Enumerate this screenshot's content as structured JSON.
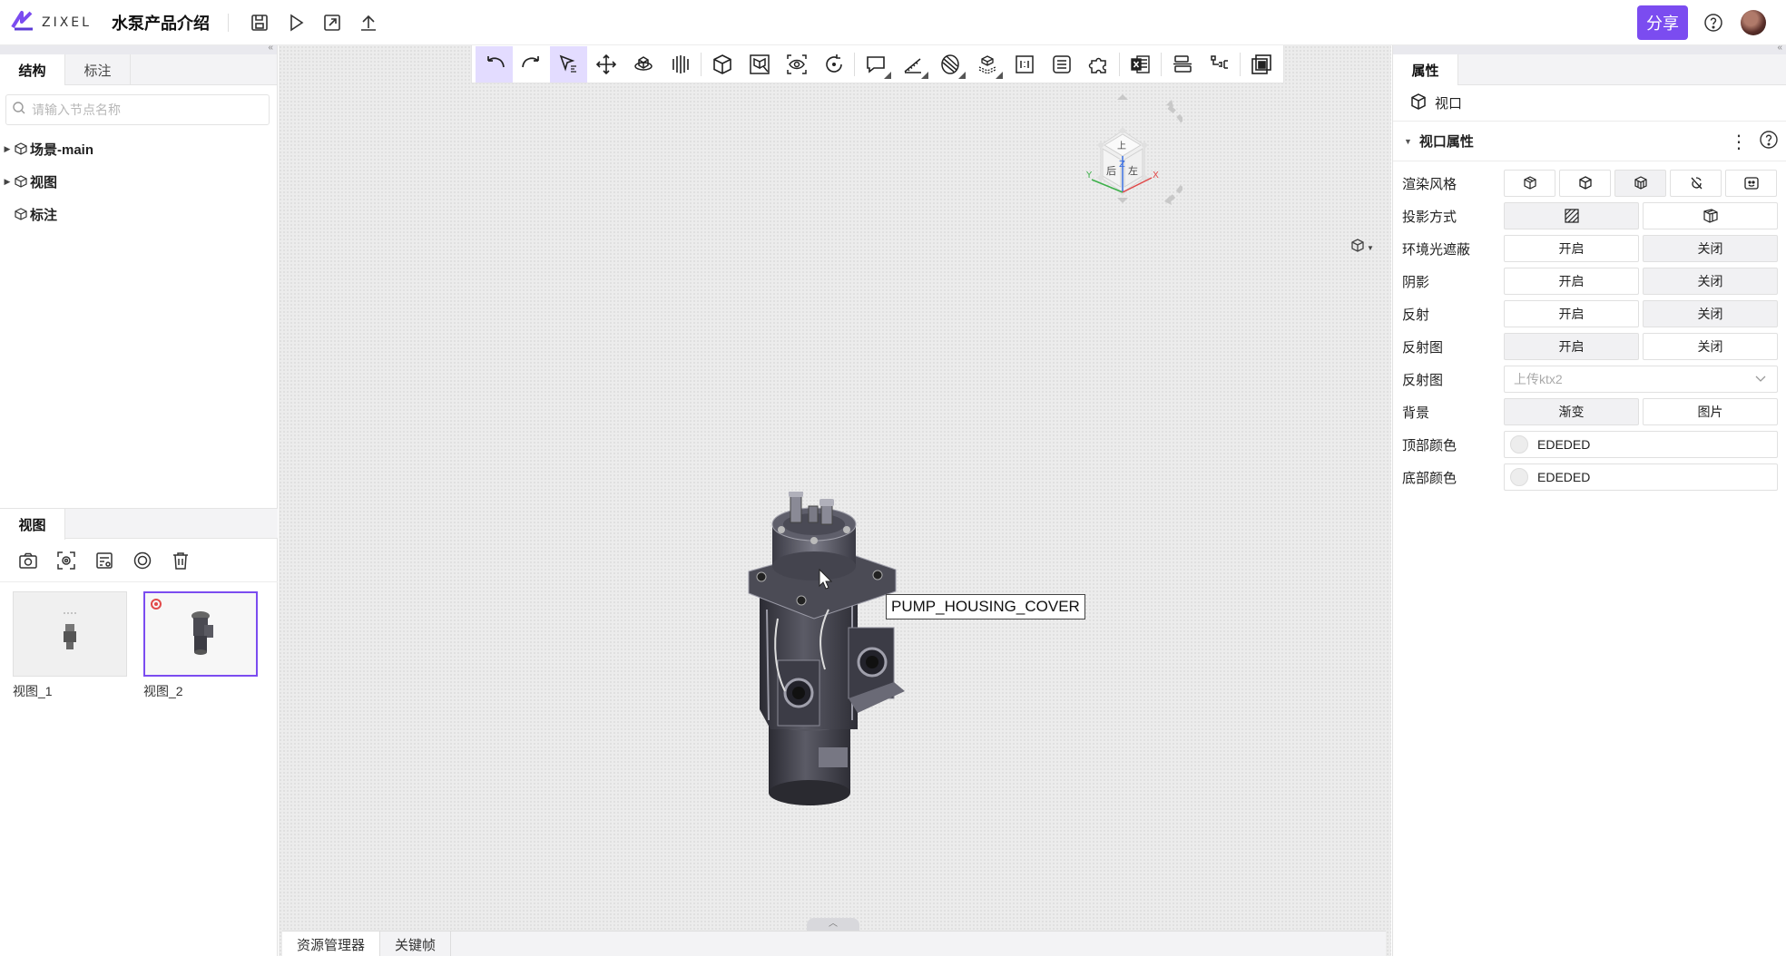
{
  "header": {
    "logo_text": "ZIXEL",
    "doc_title": "水泵产品介绍",
    "share_label": "分享",
    "brand_color": "#7b4cf0"
  },
  "left": {
    "tabs": [
      {
        "label": "结构"
      },
      {
        "label": "标注"
      }
    ],
    "search_placeholder": "请输入节点名称",
    "tree": [
      {
        "label": "场景-main"
      },
      {
        "label": "视图"
      },
      {
        "label": "标注"
      }
    ],
    "views_tab": "视图",
    "views_tool_icons": [
      "camera-icon",
      "focus-camera-icon",
      "view-list-icon",
      "target-icon",
      "trash-icon"
    ],
    "thumbnails": [
      {
        "label": "视图_1"
      },
      {
        "label": "视图_2"
      }
    ]
  },
  "viewport": {
    "toolbar_icons": [
      "undo-icon",
      "redo-icon",
      "select-icon",
      "move-icon",
      "rotate-part-icon",
      "explode-icon",
      "box-view-icon",
      "box-select-icon",
      "eye-icon",
      "refresh-icon",
      "comment-icon",
      "measure-icon",
      "section-icon",
      "layer-icon",
      "frame-icon",
      "list-icon",
      "puzzle-icon",
      "excel-icon",
      "align-icon",
      "hierarchy-icon",
      "overlay-icon"
    ],
    "tooltip": "PUMP_HOUSING_COVER",
    "bottom_tabs": [
      {
        "label": "资源管理器"
      },
      {
        "label": "关键帧"
      }
    ],
    "navcube": {
      "top": "上",
      "back": "后",
      "left": "左",
      "z": "Z",
      "x": "X",
      "y": "Y"
    }
  },
  "right": {
    "tab": "属性",
    "node_name": "视口",
    "section_title": "视口属性",
    "props": {
      "render_style": "渲染风格",
      "projection": "投影方式",
      "ao": {
        "label": "环境光遮蔽",
        "on": "开启",
        "off": "关闭"
      },
      "shadow": {
        "label": "阴影",
        "on": "开启",
        "off": "关闭"
      },
      "reflection": {
        "label": "反射",
        "on": "开启",
        "off": "关闭"
      },
      "reflection_map": {
        "label": "反射图",
        "on": "开启",
        "off": "关闭"
      },
      "reflection_map_upload": {
        "label": "反射图",
        "placeholder": "上传ktx2"
      },
      "background": {
        "label": "背景",
        "gradient": "渐变",
        "image": "图片"
      },
      "top_color": {
        "label": "顶部颜色",
        "value": "EDEDED",
        "hex": "#ededed"
      },
      "bottom_color": {
        "label": "底部颜色",
        "value": "EDEDED",
        "hex": "#ededed"
      }
    }
  }
}
